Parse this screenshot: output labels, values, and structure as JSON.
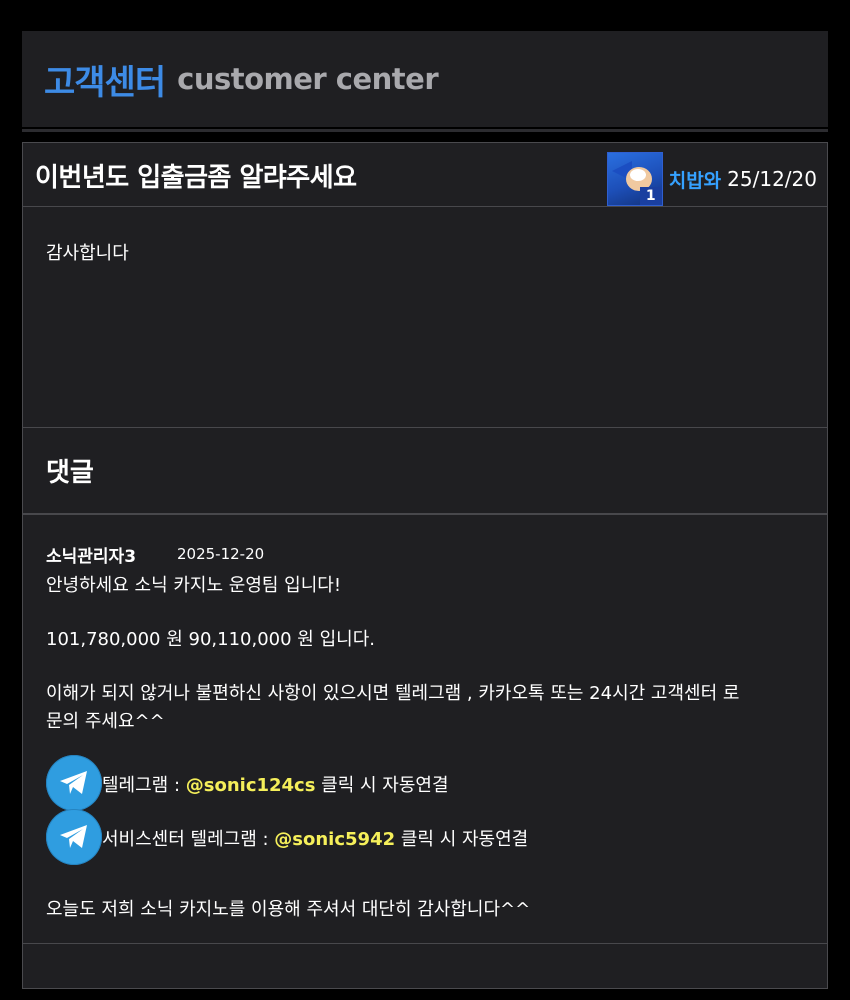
{
  "header": {
    "title": "고객센터",
    "subtitle": "customer center"
  },
  "post": {
    "title": "이번년도 입출금좀 알랴주세요",
    "author": "치밥와",
    "author_rank": "1",
    "date": "25/12/20",
    "body": "감사합니다"
  },
  "comments": {
    "title": "댓글",
    "items": [
      {
        "author": "소닉관리자3",
        "date": "2025-12-20",
        "line1": "안녕하세요 소닉 카지노 운영팀 입니다!",
        "line2": "101,780,000 원 90,110,000 원 입니다.",
        "line3": "이해가 되지 않거나 불편하신 사항이 있으시면 텔레그램 , 카카오톡 또는 24시간 고객센터 로",
        "line4": "문의 주세요^^",
        "telegram1": {
          "icon": "telegram-icon",
          "prefix": "텔레그램 : ",
          "handle": "@sonic124cs",
          "suffix": " 클릭 시 자동연결"
        },
        "telegram2": {
          "icon": "telegram-icon",
          "prefix": "서비스센터 텔레그램 : ",
          "handle": "@sonic5942",
          "suffix": " 클릭 시 자동연결"
        },
        "line5": "오늘도 저희 소닉 카지노를 이용해 주셔서 대단히 감사합니다^^"
      }
    ]
  },
  "colors": {
    "accent": "#3d8be6",
    "author_link": "#35a1ff",
    "handle_highlight": "#f5ef5a",
    "telegram": "#2f9de0"
  }
}
